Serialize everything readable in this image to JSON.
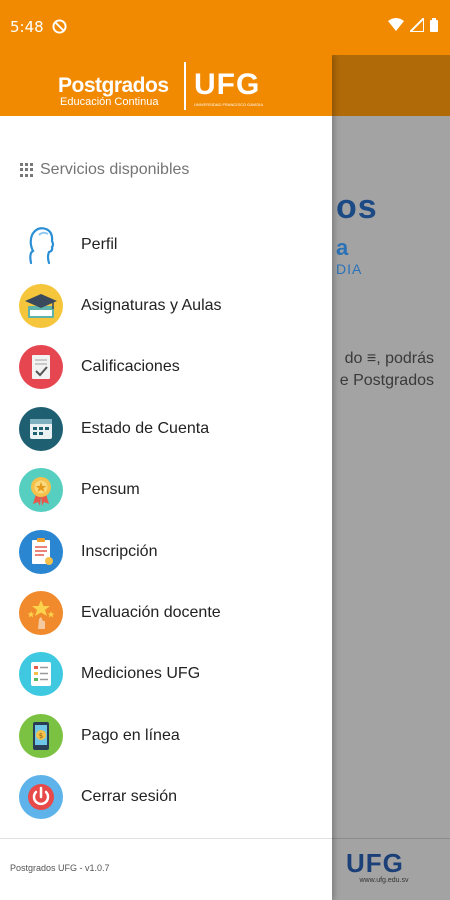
{
  "status_bar": {
    "time": "5:48"
  },
  "colors": {
    "brand_orange": "#f18a00",
    "scrim": "#a3a3a3",
    "navy": "#1b4a85"
  },
  "header": {
    "brand_postgrados": "Postgrados",
    "brand_subtitle": "Educación Continua",
    "brand_ufg": "UFG",
    "brand_ufg_sub": "UNIVERSIDAD FRANCISCO GAVIDIA"
  },
  "background": {
    "title_fragment": "os",
    "sub_fragment": "a",
    "sub2_fragment": "DIA",
    "text_line1": "do ≡, podrás",
    "text_line2": "e  Postgrados",
    "footer_logo": "UFG",
    "footer_url": "www.ufg.edu.sv"
  },
  "drawer": {
    "section_label": "Servicios disponibles",
    "items": [
      {
        "label": "Perfil",
        "icon": "profile-head-icon"
      },
      {
        "label": "Asignaturas y Aulas",
        "icon": "graduation-cap-icon"
      },
      {
        "label": "Calificaciones",
        "icon": "grades-document-icon"
      },
      {
        "label": "Estado de Cuenta",
        "icon": "account-statement-icon"
      },
      {
        "label": "Pensum",
        "icon": "medal-icon"
      },
      {
        "label": "Inscripción",
        "icon": "checklist-icon"
      },
      {
        "label": "Evaluación docente",
        "icon": "star-rating-icon"
      },
      {
        "label": "Mediciones UFG",
        "icon": "survey-board-icon"
      },
      {
        "label": "Pago en línea",
        "icon": "mobile-payment-icon"
      },
      {
        "label": "Cerrar sesión",
        "icon": "power-icon"
      }
    ],
    "version": "Postgrados UFG - v1.0.7"
  }
}
